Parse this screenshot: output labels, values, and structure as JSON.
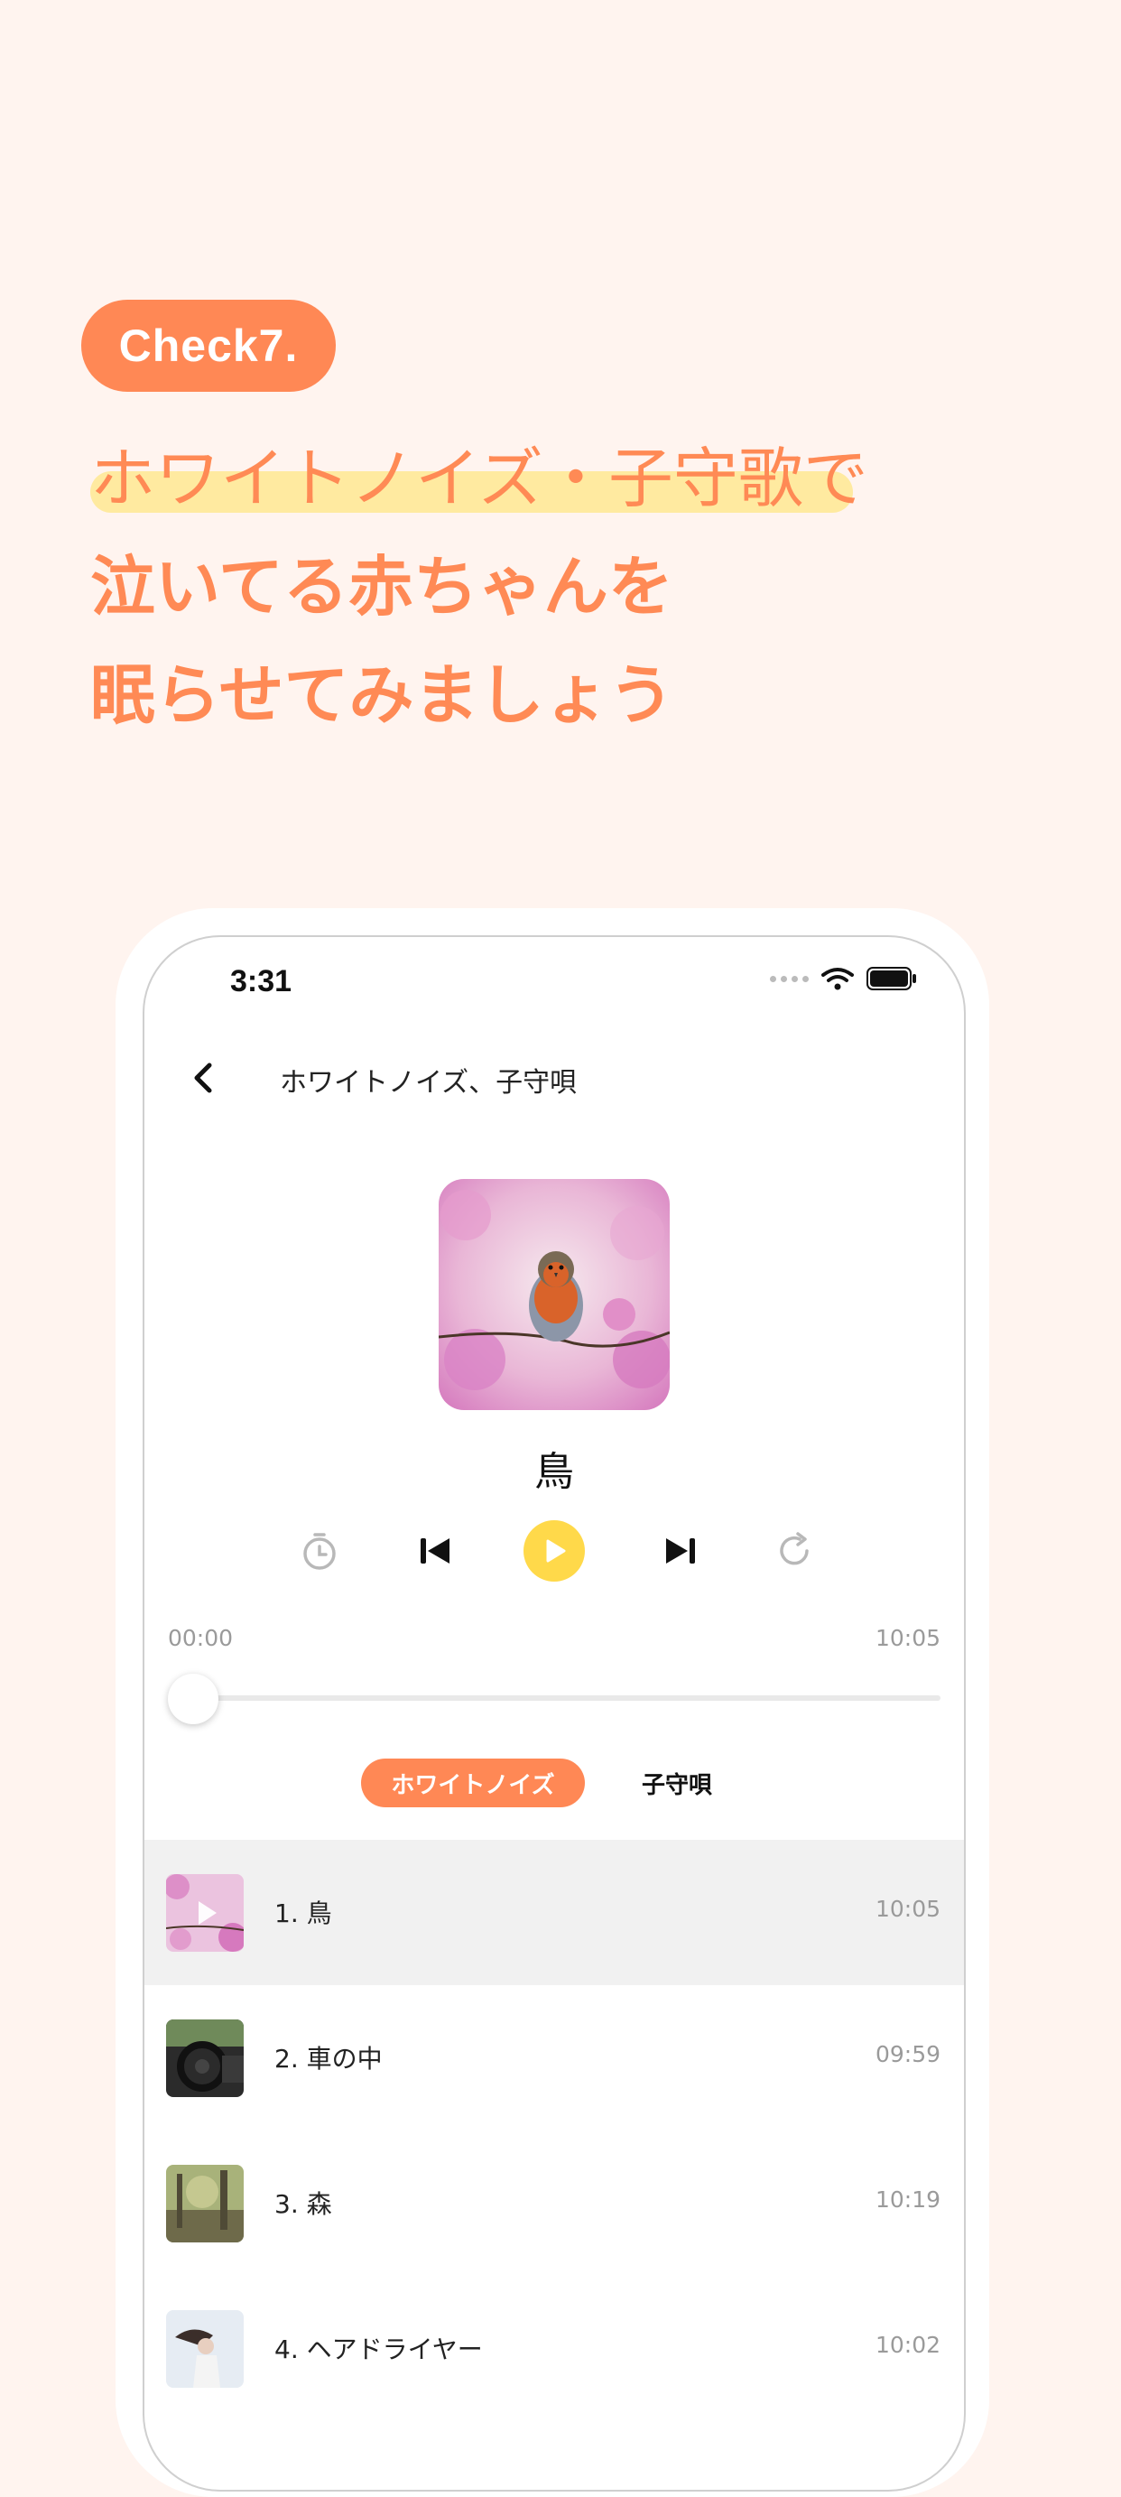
{
  "promo": {
    "badge": "Check7.",
    "headline_1": "ホワイトノイズ・子守歌で",
    "headline_2": "泣いてる赤ちゃんを",
    "headline_3": "眠らせてみましょう"
  },
  "colors": {
    "background": "#FFF4EF",
    "accent": "#FF8855",
    "highlight": "#FFEAA0",
    "play_button": "#FFD94A"
  },
  "status_bar": {
    "time": "3:31"
  },
  "nav": {
    "title": "ホワイトノイズ、子守唄"
  },
  "player": {
    "track_name": "鳥",
    "elapsed": "00:00",
    "total": "10:05",
    "progress_fraction": 0,
    "icons": [
      "timer-icon",
      "previous-icon",
      "play-icon",
      "next-icon",
      "repeat-icon"
    ]
  },
  "tabs": {
    "active": "ホワイトノイズ",
    "inactive": "子守唄"
  },
  "tracks": [
    {
      "title": "1. 鳥",
      "duration": "10:05",
      "selected": true
    },
    {
      "title": "2. 車の中",
      "duration": "09:59",
      "selected": false
    },
    {
      "title": "3. 森",
      "duration": "10:19",
      "selected": false
    },
    {
      "title": "4. ヘアドライヤー",
      "duration": "10:02",
      "selected": false
    }
  ]
}
